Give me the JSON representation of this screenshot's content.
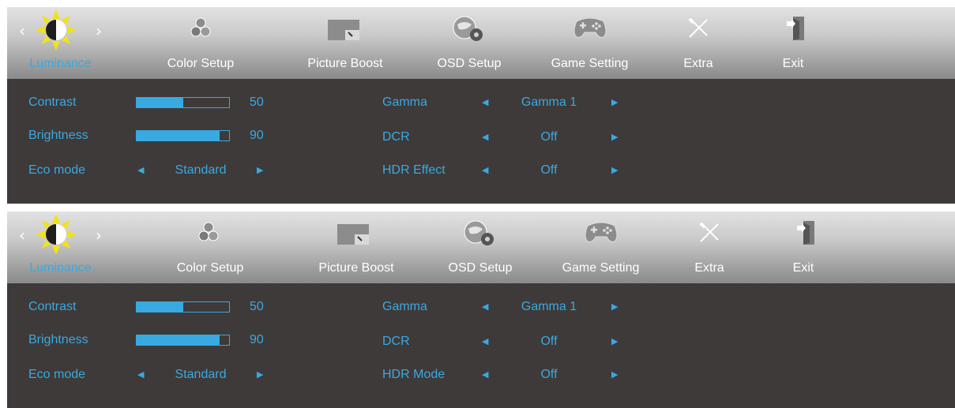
{
  "colors": {
    "accent": "#39a9e1",
    "panel": "#3e3a39",
    "menu_light": "#e2e2e2",
    "menu_dark": "#8a8a8a",
    "sun": "#f1e21a"
  },
  "arrows": {
    "left": "◀",
    "right": "▶"
  },
  "top": {
    "tabs": [
      "Luminance",
      "Color Setup",
      "Picture Boost",
      "OSD Setup",
      "Game Setting",
      "Extra",
      "Exit"
    ],
    "contrast": {
      "label": "Contrast",
      "value": "50",
      "level": 0.5
    },
    "brightness": {
      "label": "Brightness",
      "value": "90",
      "level": 0.9
    },
    "eco": {
      "label": "Eco mode",
      "value": "Standard"
    },
    "gamma": {
      "label": "Gamma",
      "value": "Gamma 1"
    },
    "dcr": {
      "label": "DCR",
      "value": "Off"
    },
    "hdr": {
      "label": "HDR Effect",
      "value": "Off"
    }
  },
  "bottom": {
    "tabs": [
      "Luminance",
      "Color Setup",
      "Picture Boost",
      "OSD Setup",
      "Game Setting",
      "Extra",
      "Exit"
    ],
    "contrast": {
      "label": "Contrast",
      "value": "50",
      "level": 0.5
    },
    "brightness": {
      "label": "Brightness",
      "value": "90",
      "level": 0.9
    },
    "eco": {
      "label": "Eco mode",
      "value": "Standard"
    },
    "gamma": {
      "label": "Gamma",
      "value": "Gamma 1"
    },
    "dcr": {
      "label": "DCR",
      "value": "Off"
    },
    "hdr": {
      "label": "HDR Mode",
      "value": "Off"
    }
  },
  "icons": [
    "luminance-sun-icon",
    "color-setup-icon",
    "picture-boost-icon",
    "osd-setup-icon",
    "game-setting-icon",
    "extra-icon",
    "exit-icon"
  ]
}
